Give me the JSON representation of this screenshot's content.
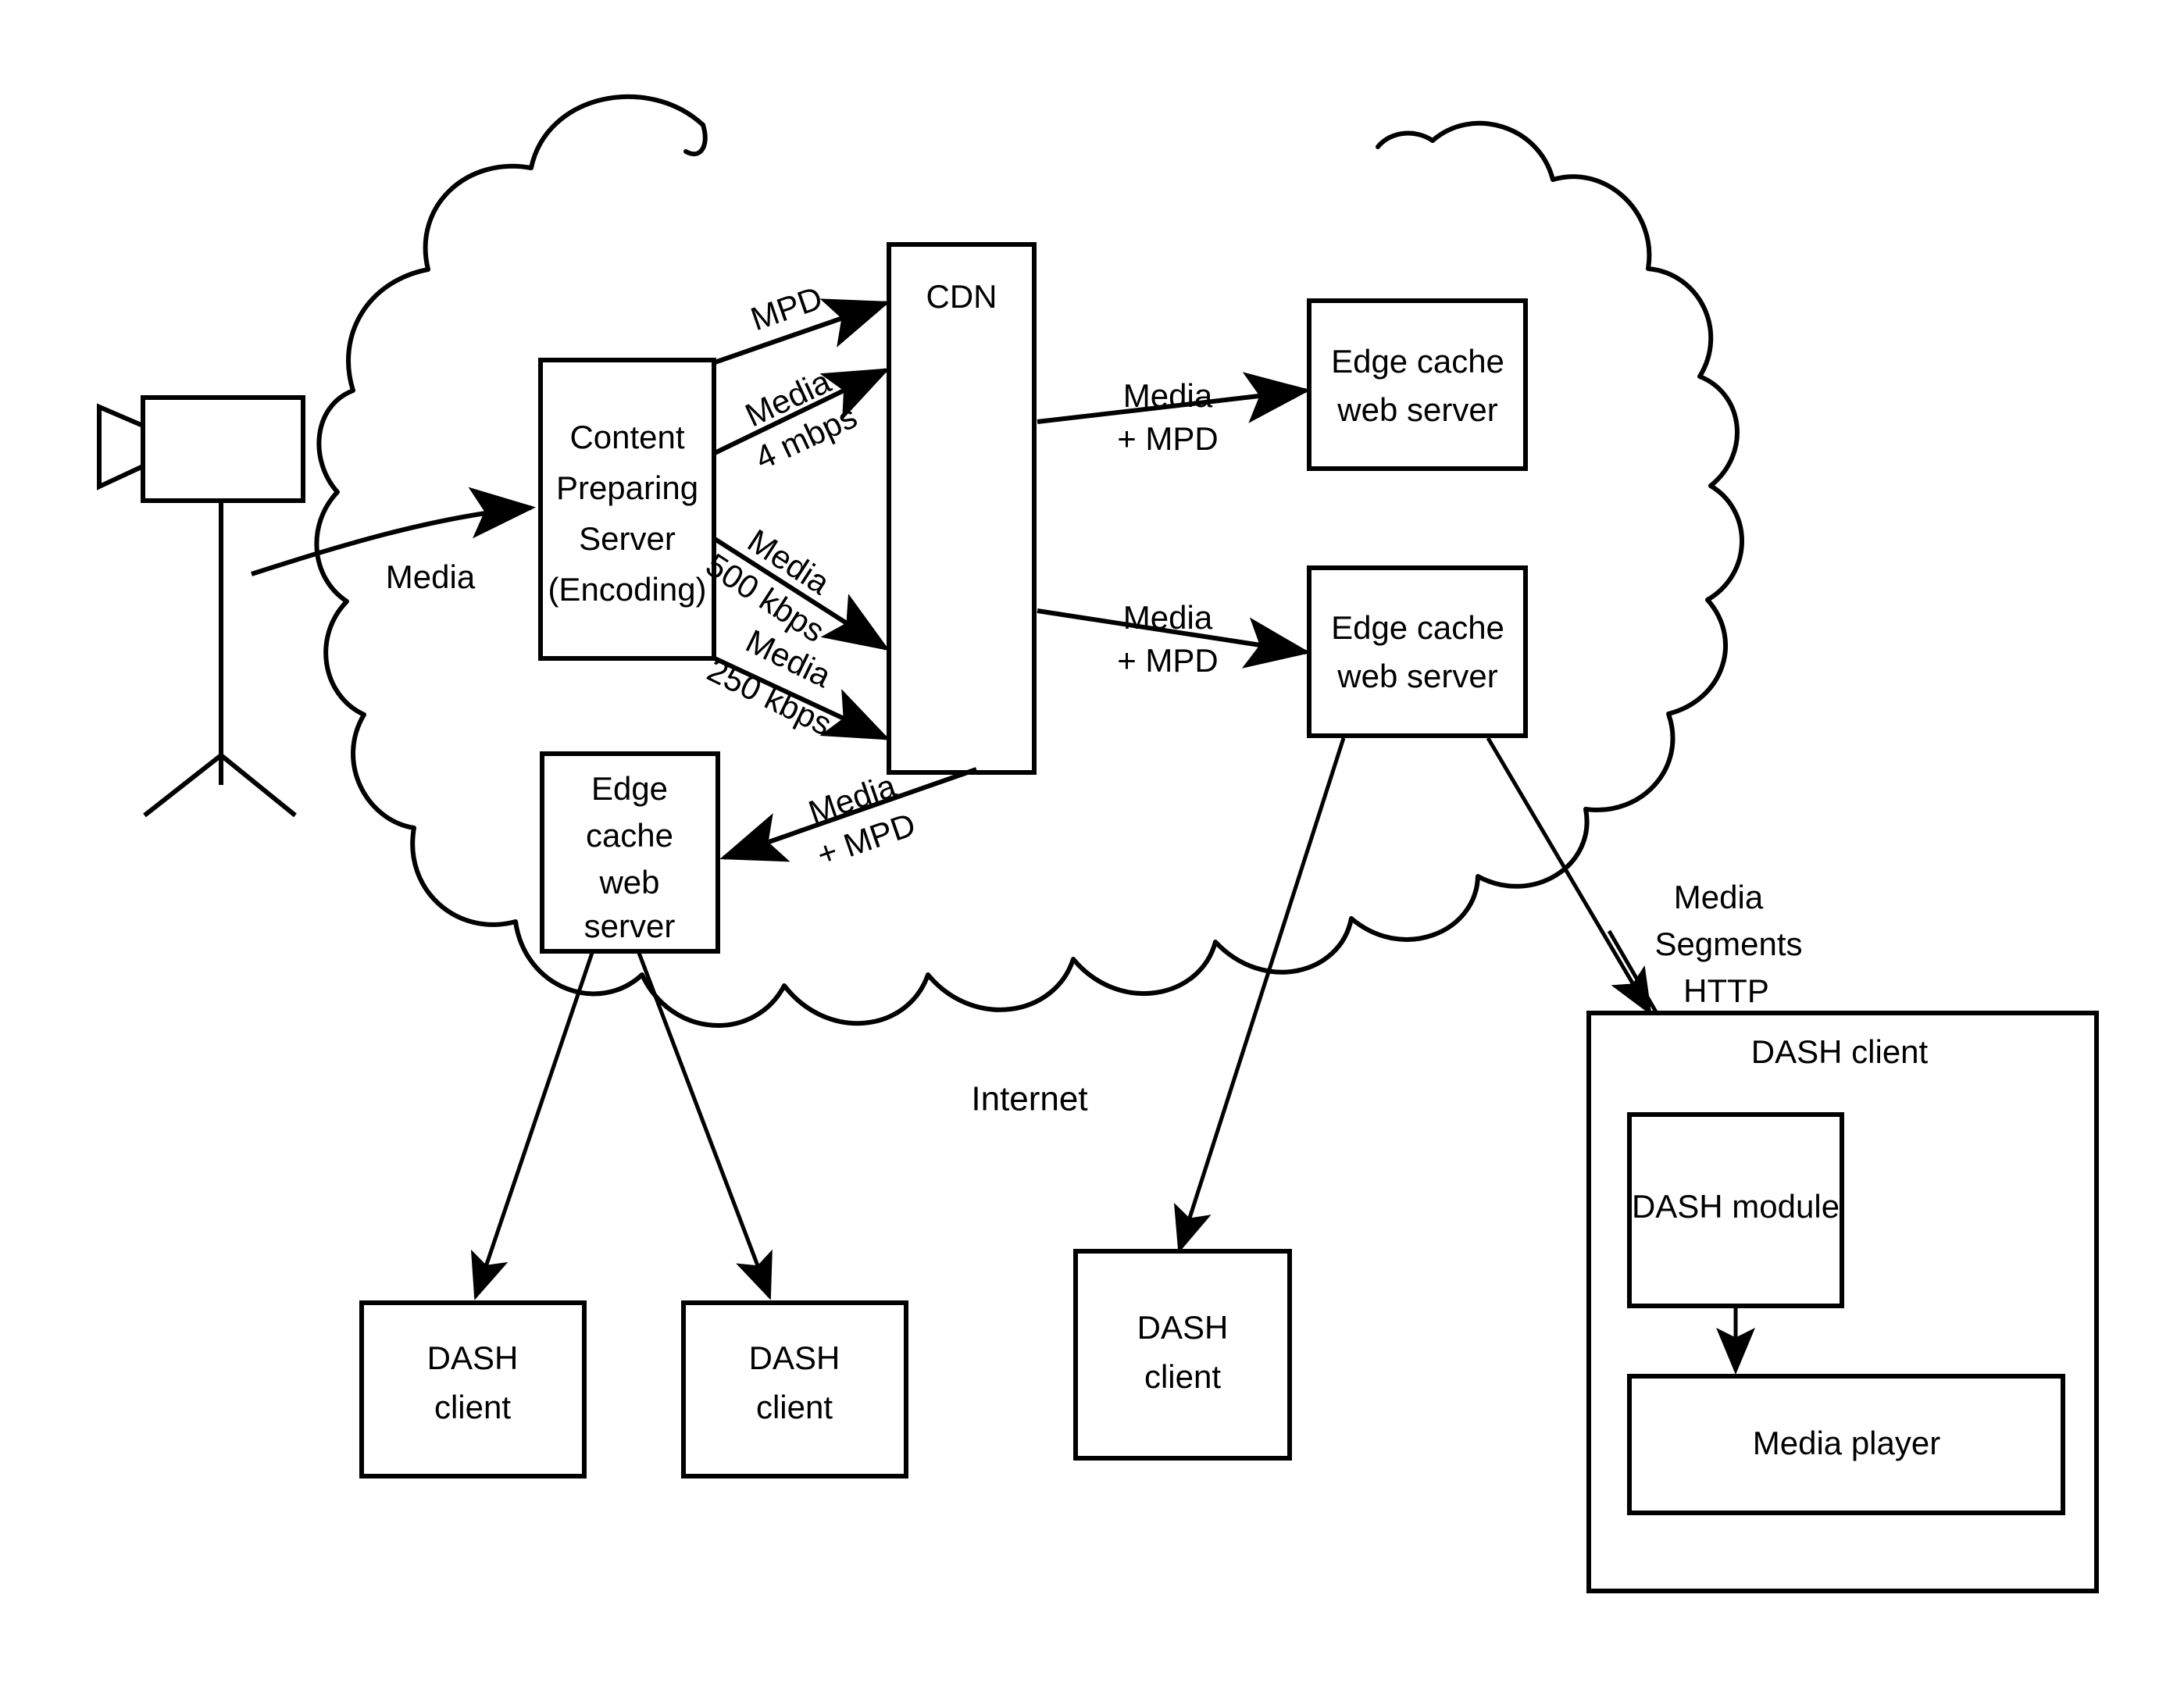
{
  "diagram": {
    "title": "MPEG-DASH content delivery network architecture",
    "cloud_label": "Internet",
    "camera": {
      "name": "video-camera"
    },
    "nodes": {
      "content_preparing_server": {
        "label": "Content\nPreparing\nServer\n(Encoding)",
        "lines": [
          "Content",
          "Preparing",
          "Server",
          "(Encoding)"
        ]
      },
      "cdn": {
        "label": "CDN"
      },
      "edge_cache_top_right": {
        "lines": [
          "Edge cache",
          "web server"
        ]
      },
      "edge_cache_mid_right": {
        "lines": [
          "Edge cache",
          "web server"
        ]
      },
      "edge_cache_left": {
        "lines": [
          "Edge",
          "cache",
          "web",
          "server"
        ]
      },
      "dash_client_1": {
        "lines": [
          "DASH",
          "client"
        ]
      },
      "dash_client_2": {
        "lines": [
          "DASH",
          "client"
        ]
      },
      "dash_client_3": {
        "lines": [
          "DASH",
          "client"
        ]
      },
      "dash_client_panel": {
        "label": "DASH client"
      },
      "dash_module": {
        "label": "DASH module"
      },
      "media_player": {
        "label": "Media player"
      }
    },
    "edges": {
      "camera_to_cps": {
        "label": "Media"
      },
      "cps_to_cdn_mpd": {
        "label": "MPD"
      },
      "cps_to_cdn_4mbps": {
        "lines": [
          "Media",
          "4 mbps"
        ]
      },
      "cps_to_cdn_500kbps": {
        "lines": [
          "Media",
          "500 kbps"
        ]
      },
      "cps_to_cdn_250kbps": {
        "lines": [
          "Media",
          "250 kbps"
        ]
      },
      "cdn_to_edge_top": {
        "lines": [
          "Media",
          "+ MPD"
        ]
      },
      "cdn_to_edge_mid": {
        "lines": [
          "Media",
          "+ MPD"
        ]
      },
      "cdn_to_edge_left": {
        "lines": [
          "Media",
          "+ MPD"
        ]
      },
      "edge_to_dash_panel": {
        "lines": [
          "Media",
          "Segments",
          "HTTP"
        ]
      }
    },
    "colors": {
      "stroke": "#000000",
      "fill": "#ffffff"
    }
  }
}
